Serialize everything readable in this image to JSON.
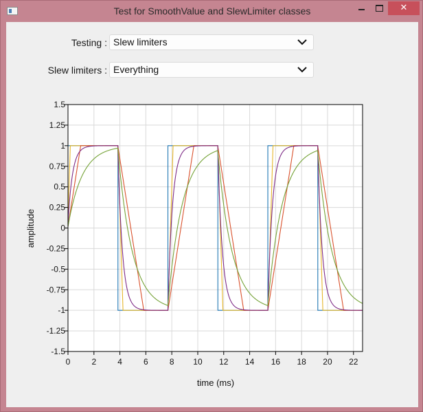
{
  "window": {
    "title": "Test for SmoothValue and SlewLimiter classes",
    "minimize_glyph": "",
    "maximize_glyph": "",
    "close_glyph": "✕"
  },
  "controls": {
    "testing_label": "Testing :",
    "testing_value": "Slew limiters",
    "slew_label": "Slew limiters :",
    "slew_value": "Everything"
  },
  "colors": {
    "blue": "#1f77b4",
    "yellow": "#e5b62a",
    "red": "#d9502b",
    "purple": "#7d2a86",
    "green": "#74a236",
    "close_button": "#c7505b"
  },
  "chart_data": {
    "type": "line",
    "xlabel": "time (ms)",
    "ylabel": "amplitude",
    "xlim": [
      0,
      22.7
    ],
    "ylim": [
      -1.5,
      1.5
    ],
    "xticks": [
      0,
      2,
      4,
      6,
      8,
      10,
      12,
      14,
      16,
      18,
      20,
      22
    ],
    "yticks": [
      1.5,
      1.25,
      1,
      0.75,
      0.5,
      0.25,
      0,
      -0.25,
      -0.5,
      -0.75,
      -1,
      -1.25,
      -1.5
    ],
    "ytick_labels": [
      "1.5",
      "1.25",
      "1",
      "0.75",
      "0.5",
      "0.25",
      "0",
      "-0.25",
      "-0.5",
      "-0.75",
      "-1",
      "-1.25",
      "-1.5"
    ],
    "grid": true,
    "square_wave": {
      "half_period_ms": 3.85,
      "start_value": 1,
      "edges_ms": [
        0,
        3.85,
        7.7,
        11.55,
        15.4,
        19.25
      ]
    },
    "series": [
      {
        "kind": "step",
        "color": "#1f77b4"
      },
      {
        "kind": "linear",
        "ramp_ms": 0.4,
        "color": "#e5b62a"
      },
      {
        "kind": "linear",
        "ramp_ms": 2.0,
        "color": "#d9502b"
      },
      {
        "kind": "exp",
        "tau_ms": 0.35,
        "color": "#7d2a86"
      },
      {
        "kind": "exp",
        "tau_ms": 1.1,
        "color": "#74a236"
      }
    ]
  }
}
